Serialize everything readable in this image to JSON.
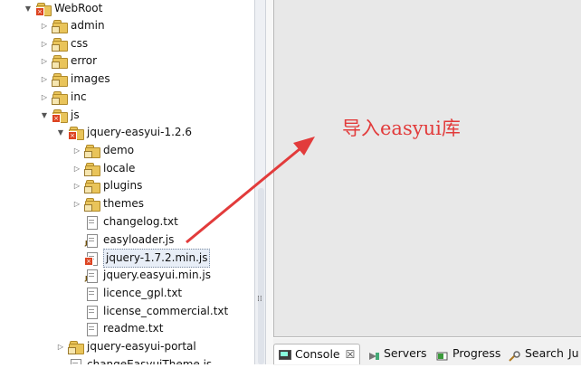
{
  "tree": {
    "items": [
      {
        "label": "WebRoot",
        "twisty": "▼",
        "icon": "folder-icon",
        "error": true
      },
      {
        "label": "admin",
        "twisty": "▷",
        "icon": "folder-icon"
      },
      {
        "label": "css",
        "twisty": "▷",
        "icon": "folder-icon"
      },
      {
        "label": "error",
        "twisty": "▷",
        "icon": "folder-icon"
      },
      {
        "label": "images",
        "twisty": "▷",
        "icon": "folder-icon"
      },
      {
        "label": "inc",
        "twisty": "▷",
        "icon": "folder-icon"
      },
      {
        "label": "js",
        "twisty": "▼",
        "icon": "folder-icon",
        "error": true
      },
      {
        "label": "jquery-easyui-1.2.6",
        "twisty": "▼",
        "icon": "folder-icon",
        "error": true
      },
      {
        "label": "demo",
        "twisty": "▷",
        "icon": "folder-icon"
      },
      {
        "label": "locale",
        "twisty": "▷",
        "icon": "folder-icon"
      },
      {
        "label": "plugins",
        "twisty": "▷",
        "icon": "folder-icon"
      },
      {
        "label": "themes",
        "twisty": "▷",
        "icon": "folder-icon"
      },
      {
        "label": "changelog.txt",
        "twisty": "",
        "icon": "text-file-icon"
      },
      {
        "label": "easyloader.js",
        "twisty": "",
        "icon": "js-file-icon"
      },
      {
        "label": "jquery-1.7.2.min.js",
        "twisty": "",
        "icon": "js-file-icon",
        "error": true,
        "selected": true
      },
      {
        "label": "jquery.easyui.min.js",
        "twisty": "",
        "icon": "js-file-icon"
      },
      {
        "label": "licence_gpl.txt",
        "twisty": "",
        "icon": "text-file-icon"
      },
      {
        "label": "license_commercial.txt",
        "twisty": "",
        "icon": "text-file-icon"
      },
      {
        "label": "readme.txt",
        "twisty": "",
        "icon": "text-file-icon"
      },
      {
        "label": "jquery-easyui-portal",
        "twisty": "▷",
        "icon": "folder-icon"
      },
      {
        "label": "changeEasyuiTheme.js",
        "twisty": "",
        "icon": "js-file-icon"
      }
    ]
  },
  "annotation": {
    "text": "导入easyui库",
    "color": "#e23b3b"
  },
  "bottom_tabs": {
    "console": {
      "label": "Console",
      "close": "☒"
    },
    "servers": {
      "label": "Servers"
    },
    "progress": {
      "label": "Progress"
    },
    "search": {
      "label": "Search"
    },
    "overflow": {
      "label": "Ju"
    }
  },
  "splitter": {
    "grip": "⁞⁞"
  }
}
